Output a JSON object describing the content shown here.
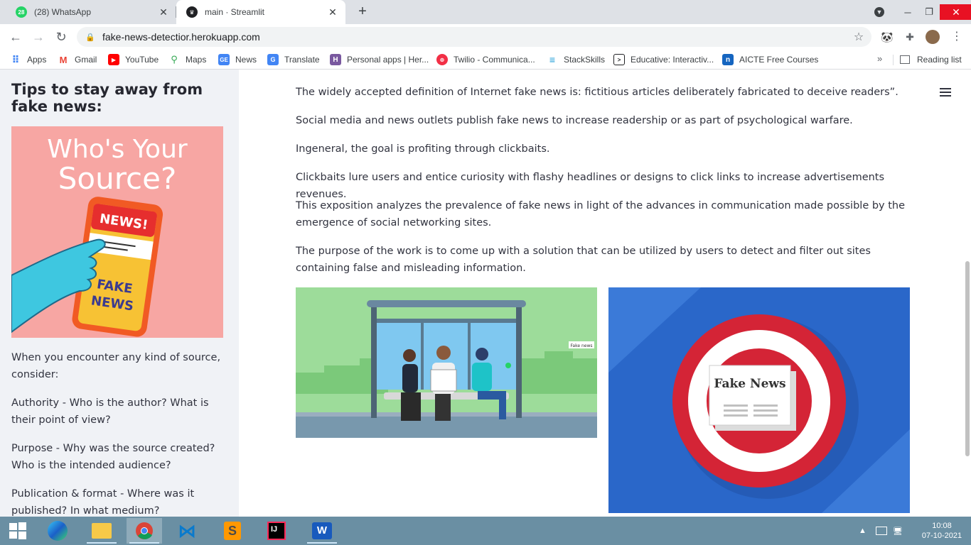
{
  "browser": {
    "tabs": [
      {
        "title": "(28) WhatsApp",
        "badge": "28",
        "favicon": "whatsapp-icon",
        "active": false
      },
      {
        "title": "main · Streamlit",
        "favicon": "streamlit-icon",
        "active": true
      }
    ],
    "url": "fake-news-detectior.herokuapp.com",
    "bookmarks": [
      {
        "label": "Apps",
        "icon": "apps-grid-icon"
      },
      {
        "label": "Gmail",
        "icon": "gmail-icon"
      },
      {
        "label": "YouTube",
        "icon": "youtube-icon"
      },
      {
        "label": "Maps",
        "icon": "maps-icon"
      },
      {
        "label": "News",
        "icon": "news-icon"
      },
      {
        "label": "Translate",
        "icon": "translate-icon"
      },
      {
        "label": "Personal apps | Her...",
        "icon": "heroku-icon"
      },
      {
        "label": "Twilio - Communica...",
        "icon": "twilio-icon"
      },
      {
        "label": "StackSkills",
        "icon": "stackskills-icon"
      },
      {
        "label": "Educative: Interactiv...",
        "icon": "educative-icon"
      },
      {
        "label": "AICTE Free Courses",
        "icon": "aicte-icon"
      }
    ],
    "more": "»",
    "reading_list": "Reading list"
  },
  "sidebar": {
    "title": "Tips to stay away from fake news:",
    "image_text": {
      "line1": "Who's Your",
      "line2": "Source?",
      "phone_header": "NEWS!",
      "phone_body_1": "FAKE",
      "phone_body_2": "NEWS"
    },
    "paragraphs": [
      "When you encounter any kind of source, consider:",
      "Authority - Who is the author? What is their point of view?",
      "Purpose - Why was the source created? Who is the intended audience?",
      "Publication & format - Where was it published? In what medium?"
    ]
  },
  "main": {
    "paragraphs": [
      "The widely accepted definition of Internet fake news is: fictitious articles deliberately fabricated to deceive readers”.",
      "Social media and news outlets publish fake news to increase readership or as part of psychological warfare.",
      "Ingeneral, the goal is profiting through clickbaits.",
      "Clickbaits lure users and entice curiosity with flashy headlines or designs to click links to increase advertisements revenues.",
      "This exposition analyzes the prevalence of fake news in light of the advances in communication made possible by the emergence of social networking sites.",
      "The purpose of the work is to come up with a solution that can be utilized by users to detect and filter out sites containing false and misleading information."
    ],
    "image1_label": "Fake news",
    "image2_label": "Fake News"
  },
  "taskbar": {
    "apps": [
      "windows-start-icon",
      "edge-icon",
      "file-explorer-icon",
      "chrome-icon",
      "vscode-icon",
      "sublime-text-icon",
      "intellij-icon",
      "word-icon"
    ],
    "time": "10:08",
    "date": "07-10-2021"
  },
  "colors": {
    "sidebar_bg": "#f0f2f6",
    "text": "#31333f",
    "close_red": "#e81123"
  }
}
